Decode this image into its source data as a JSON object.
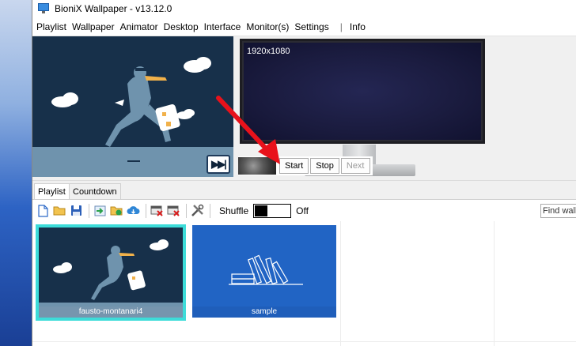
{
  "window": {
    "title": "BioniX Wallpaper  -  v13.12.0",
    "icon": "monitor-icon"
  },
  "menu": {
    "items": [
      "Playlist",
      "Wallpaper",
      "Animator",
      "Desktop",
      "Interface",
      "Monitor(s)",
      "Settings"
    ],
    "separator": "|",
    "info": "Info"
  },
  "preview": {
    "resolution": "1920x1080",
    "next_glyph": "▶▶|",
    "controls": {
      "start": "Start",
      "stop": "Stop",
      "next": "Next"
    }
  },
  "tabs": [
    "Playlist",
    "Countdown"
  ],
  "toolbar": {
    "icons": [
      "new-file-icon",
      "open-folder-icon",
      "save-icon",
      "import-icon",
      "add-folder-icon",
      "cloud-download-icon",
      "remove-selected-icon",
      "clear-list-icon",
      "tools-icon"
    ],
    "shuffle_label": "Shuffle",
    "shuffle_state": "Off",
    "find_placeholder": "Find wallpa"
  },
  "playlist": {
    "items": [
      {
        "name": "fausto-montanari4",
        "selected": true
      },
      {
        "name": "sample",
        "selected": false
      }
    ]
  },
  "colors": {
    "selection_border": "#3ddcd9",
    "arrow": "#e8121b",
    "wallpaper_bg": "#17304a",
    "sample_bg": "#2164c4"
  }
}
